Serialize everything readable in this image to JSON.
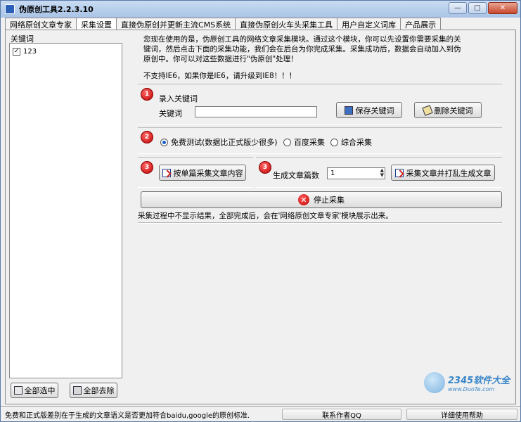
{
  "window": {
    "title": "伪原创工具2.2.3.10",
    "minimize": "—",
    "maximize": "□",
    "close": "✕"
  },
  "tabs": [
    {
      "label": "网络原创文章专家"
    },
    {
      "label": "采集设置"
    },
    {
      "label": "直接伪原创并更新主流CMS系统"
    },
    {
      "label": "直接伪原创火车头采集工具"
    },
    {
      "label": "用户自定义词库"
    },
    {
      "label": "产品展示"
    }
  ],
  "left": {
    "header": "关键词",
    "items": [
      {
        "label": "123",
        "checked": "✓"
      }
    ],
    "select_all": "全部选中",
    "deselect_all": "全部去除"
  },
  "intro": {
    "text": "您现在使用的是，伪原创工具的网络文章采集模块。通过这个模块，你可以先设置你需要采集的关键词，然后点击下面的采集功能，我们会在后台为你完成采集。采集成功后，数据会自动加入到伪原创中。你可以对这些数据进行\"伪原创\"处理！",
    "warning": "不支持IE6，如果你是IE6，请升级到IE8！！！"
  },
  "step1": {
    "badge": "1",
    "title": "录入关键词",
    "field_label": "关键词",
    "field_value": "",
    "save": "保存关键词",
    "delete": "删除关键词"
  },
  "step2": {
    "badge": "2",
    "options": [
      {
        "label": "免费测试(数据比正式版少很多)"
      },
      {
        "label": "百度采集"
      },
      {
        "label": "综合采集"
      }
    ]
  },
  "step3a": {
    "badge": "3",
    "button": "按单篇采集文章内容"
  },
  "step3b": {
    "badge": "3",
    "count_label": "生成文章篇数",
    "count_value": "1",
    "button": "采集文章并打乱生成文章"
  },
  "stop": {
    "icon": "✕",
    "label": "停止采集"
  },
  "note": "采集过程中不显示结果，全部完成后，会在'网络原创文章专家'模块展示出来。",
  "status": {
    "message": "免费和正式版差别在于生成的文章语义是否更加符合baidu,google的原创标准.",
    "contact": "联系作者QQ",
    "help": "详细使用帮助"
  },
  "watermark": {
    "brand": "2345软件大全",
    "url": "www.DuoTe.com"
  }
}
